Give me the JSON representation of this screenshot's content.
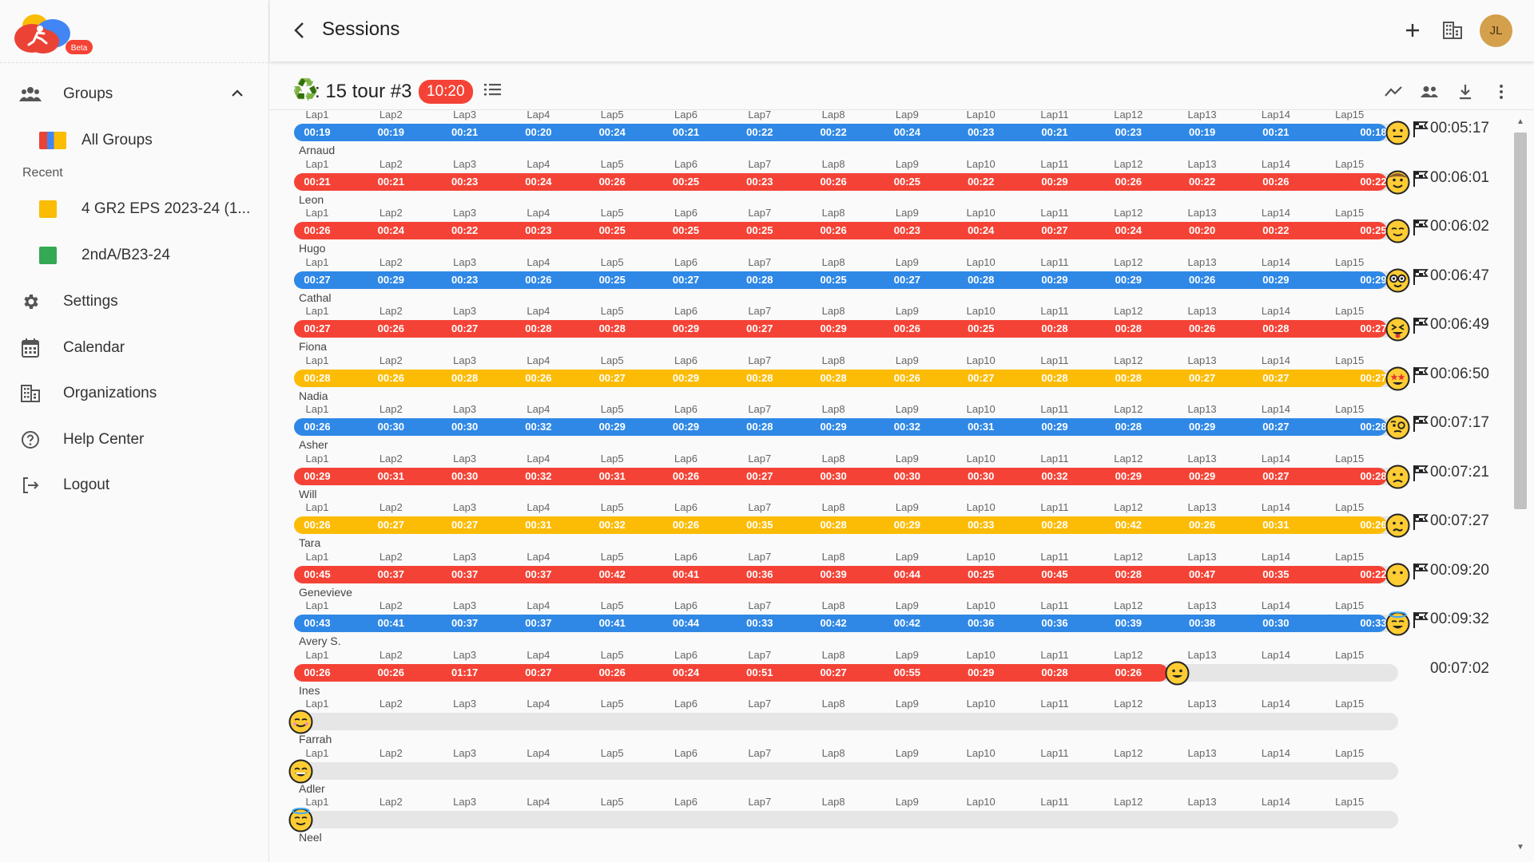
{
  "app": {
    "beta_label": "Beta"
  },
  "sidebar": {
    "groups_label": "Groups",
    "all_groups_label": "All Groups",
    "recent_label": "Recent",
    "recent_items": [
      {
        "label": "4 GR2 EPS 2023-24 (1...",
        "color": "#fbbc04"
      },
      {
        "label": "2ndA/B23-24",
        "color": "#34a853"
      }
    ],
    "settings_label": "Settings",
    "calendar_label": "Calendar",
    "organizations_label": "Organizations",
    "help_label": "Help Center",
    "logout_label": "Logout"
  },
  "header": {
    "title": "Sessions",
    "avatar_initials": "JL"
  },
  "session": {
    "title": ": 15 tour #3",
    "time_badge": "10:20",
    "lap_labels": [
      "Lap1",
      "Lap2",
      "Lap3",
      "Lap4",
      "Lap5",
      "Lap6",
      "Lap7",
      "Lap8",
      "Lap9",
      "Lap10",
      "Lap11",
      "Lap12",
      "Lap13",
      "Lap14",
      "Lap15"
    ],
    "rows": [
      {
        "name": "Arnaud",
        "color": "blue",
        "emoji": "neutral",
        "total": "00:05:17",
        "finished": true,
        "times": [
          "00:19",
          "00:19",
          "00:21",
          "00:20",
          "00:24",
          "00:21",
          "00:22",
          "00:22",
          "00:24",
          "00:23",
          "00:21",
          "00:23",
          "00:19",
          "00:21",
          "00:18"
        ]
      },
      {
        "name": "Leon",
        "color": "red",
        "emoji": "cowboy",
        "total": "00:06:01",
        "finished": true,
        "times": [
          "00:21",
          "00:21",
          "00:23",
          "00:24",
          "00:26",
          "00:25",
          "00:23",
          "00:26",
          "00:25",
          "00:22",
          "00:29",
          "00:26",
          "00:22",
          "00:26",
          "00:22"
        ]
      },
      {
        "name": "Hugo",
        "color": "red",
        "emoji": "relieved",
        "total": "00:06:02",
        "finished": true,
        "times": [
          "00:26",
          "00:24",
          "00:22",
          "00:23",
          "00:25",
          "00:25",
          "00:25",
          "00:26",
          "00:23",
          "00:24",
          "00:27",
          "00:24",
          "00:20",
          "00:22",
          "00:25"
        ]
      },
      {
        "name": "Cathal",
        "color": "blue",
        "emoji": "nerd",
        "total": "00:06:47",
        "finished": true,
        "times": [
          "00:27",
          "00:29",
          "00:23",
          "00:26",
          "00:25",
          "00:27",
          "00:28",
          "00:25",
          "00:27",
          "00:28",
          "00:29",
          "00:29",
          "00:26",
          "00:29",
          "00:29"
        ]
      },
      {
        "name": "Fiona",
        "color": "red",
        "emoji": "squint-tongue",
        "total": "00:06:49",
        "finished": true,
        "times": [
          "00:27",
          "00:26",
          "00:27",
          "00:28",
          "00:28",
          "00:29",
          "00:27",
          "00:29",
          "00:26",
          "00:25",
          "00:28",
          "00:28",
          "00:26",
          "00:28",
          "00:27"
        ]
      },
      {
        "name": "Nadia",
        "color": "yellow",
        "emoji": "star-struck",
        "total": "00:06:50",
        "finished": true,
        "times": [
          "00:28",
          "00:26",
          "00:28",
          "00:26",
          "00:27",
          "00:29",
          "00:28",
          "00:28",
          "00:26",
          "00:27",
          "00:28",
          "00:28",
          "00:27",
          "00:27",
          "00:27"
        ]
      },
      {
        "name": "Asher",
        "color": "blue",
        "emoji": "monocle",
        "total": "00:07:17",
        "finished": true,
        "times": [
          "00:26",
          "00:30",
          "00:30",
          "00:32",
          "00:29",
          "00:29",
          "00:28",
          "00:29",
          "00:32",
          "00:31",
          "00:29",
          "00:28",
          "00:29",
          "00:27",
          "00:28"
        ]
      },
      {
        "name": "Will",
        "color": "red",
        "emoji": "frown",
        "total": "00:07:21",
        "finished": true,
        "times": [
          "00:29",
          "00:31",
          "00:30",
          "00:32",
          "00:31",
          "00:26",
          "00:27",
          "00:30",
          "00:30",
          "00:30",
          "00:32",
          "00:29",
          "00:29",
          "00:27",
          "00:28"
        ]
      },
      {
        "name": "Tara",
        "color": "yellow",
        "emoji": "confused",
        "total": "00:07:27",
        "finished": true,
        "times": [
          "00:26",
          "00:27",
          "00:27",
          "00:31",
          "00:32",
          "00:26",
          "00:35",
          "00:28",
          "00:29",
          "00:33",
          "00:28",
          "00:42",
          "00:26",
          "00:31",
          "00:26"
        ]
      },
      {
        "name": "Genevieve",
        "color": "red",
        "emoji": "no-mouth",
        "total": "00:09:20",
        "finished": true,
        "times": [
          "00:45",
          "00:37",
          "00:37",
          "00:37",
          "00:42",
          "00:41",
          "00:36",
          "00:39",
          "00:44",
          "00:25",
          "00:45",
          "00:28",
          "00:47",
          "00:35",
          "00:22"
        ]
      },
      {
        "name": "Avery S.",
        "color": "blue",
        "emoji": "halo-smile",
        "total": "00:09:32",
        "finished": true,
        "times": [
          "00:43",
          "00:41",
          "00:37",
          "00:37",
          "00:41",
          "00:44",
          "00:33",
          "00:42",
          "00:42",
          "00:36",
          "00:36",
          "00:39",
          "00:38",
          "00:30",
          "00:33"
        ]
      },
      {
        "name": "Ines",
        "color": "red",
        "emoji": "grin",
        "total": "00:07:02",
        "finished": false,
        "times": [
          "00:26",
          "00:26",
          "01:17",
          "00:27",
          "00:26",
          "00:24",
          "00:51",
          "00:27",
          "00:55",
          "00:29",
          "00:28",
          "00:26"
        ]
      },
      {
        "name": "Farrah",
        "color": "red",
        "emoji": "blush-smile",
        "total": "",
        "finished": false,
        "times": []
      },
      {
        "name": "Adler",
        "color": "red",
        "emoji": "big-grin",
        "total": "",
        "finished": false,
        "times": []
      },
      {
        "name": "Neel",
        "color": "red",
        "emoji": "halo",
        "total": "",
        "finished": false,
        "times": []
      }
    ]
  }
}
